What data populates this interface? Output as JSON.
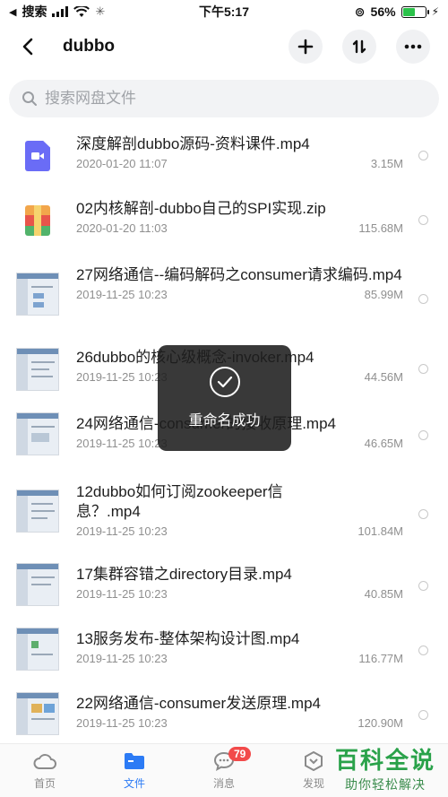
{
  "status_bar": {
    "carrier": "搜索",
    "time": "下午5:17",
    "battery_percent": "56%",
    "battery_level": 0.56
  },
  "header": {
    "title": "dubbo"
  },
  "search": {
    "placeholder": "搜索网盘文件"
  },
  "files": [
    {
      "name": "深度解剖dubbo源码-资料课件.mp4",
      "date": "2020-01-20 11:07",
      "size": "3.15M",
      "thumb": "video-icon"
    },
    {
      "name": "02内核解剖-dubbo自己的SPI实现.zip",
      "date": "2020-01-20 11:03",
      "size": "115.68M",
      "thumb": "zip-icon"
    },
    {
      "name": "27网络通信--编码解码之consumer请求编码.mp4",
      "date": "2019-11-25 10:23",
      "size": "85.99M",
      "thumb": "screenshot-thumb"
    },
    {
      "name": "26dubbo的核心级概念-invoker.mp4",
      "date": "2019-11-25 10:23",
      "size": "44.56M",
      "thumb": "screenshot-thumb"
    },
    {
      "name": "24网络通信-consumer的接收原理.mp4",
      "date": "2019-11-25 10:23",
      "size": "46.65M",
      "thumb": "screenshot-thumb"
    },
    {
      "name": "12dubbo如何订阅zookeeper信息？.mp4",
      "date": "2019-11-25 10:23",
      "size": "101.84M",
      "thumb": "screenshot-thumb"
    },
    {
      "name": "17集群容错之directory目录.mp4",
      "date": "2019-11-25 10:23",
      "size": "40.85M",
      "thumb": "screenshot-thumb"
    },
    {
      "name": "13服务发布-整体架构设计图.mp4",
      "date": "2019-11-25 10:23",
      "size": "116.77M",
      "thumb": "screenshot-thumb"
    },
    {
      "name": "22网络通信-consumer发送原理.mp4",
      "date": "2019-11-25 10:23",
      "size": "120.90M",
      "thumb": "screenshot-thumb"
    }
  ],
  "toast": {
    "message": "重命名成功"
  },
  "tabbar": {
    "tabs": [
      {
        "label": "首页",
        "icon": "cloud-icon"
      },
      {
        "label": "文件",
        "icon": "folder-icon"
      },
      {
        "label": "消息",
        "icon": "message-icon"
      },
      {
        "label": "发现",
        "icon": "discover-icon"
      }
    ],
    "message_badge": "79",
    "active_color": "#2c7bf5"
  },
  "watermark": {
    "title": "百科全说",
    "subtitle": "助你轻松解决"
  }
}
